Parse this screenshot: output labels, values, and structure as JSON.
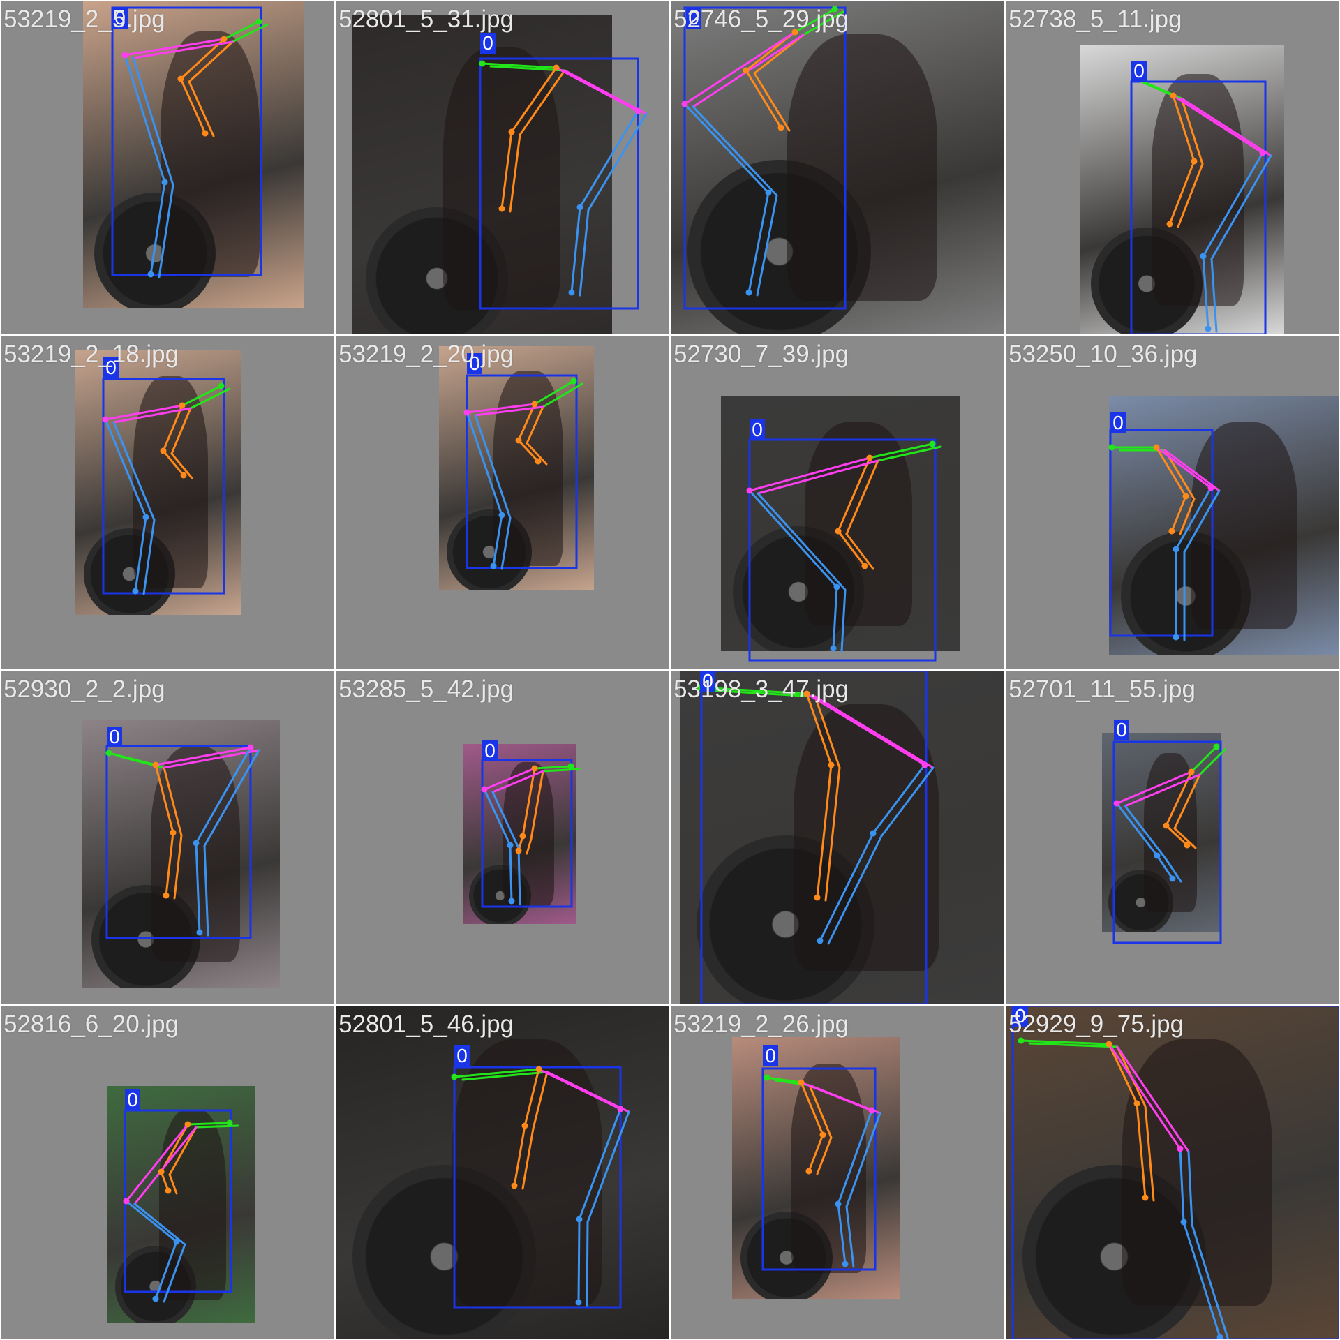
{
  "mosaic": {
    "tiles": [
      {
        "filename": "53219_2_5.jpg",
        "class_label": "0",
        "photo_tone": "#c9a38a"
      },
      {
        "filename": "52801_5_31.jpg",
        "class_label": "0",
        "photo_tone": "#2d2a29"
      },
      {
        "filename": "52746_5_29.jpg",
        "class_label": "0",
        "photo_tone": "#7f7f7f"
      },
      {
        "filename": "52738_5_11.jpg",
        "class_label": "0",
        "photo_tone": "#d9d9d9"
      },
      {
        "filename": "53219_2_18.jpg",
        "class_label": "0",
        "photo_tone": "#c6a48e"
      },
      {
        "filename": "53219_2_20.jpg",
        "class_label": "0",
        "photo_tone": "#c6a48e"
      },
      {
        "filename": "52730_7_39.jpg",
        "class_label": "0",
        "photo_tone": "#3a3a3a"
      },
      {
        "filename": "53250_10_36.jpg",
        "class_label": "0",
        "photo_tone": "#7b8ca8"
      },
      {
        "filename": "52930_2_2.jpg",
        "class_label": "0",
        "photo_tone": "#8e8488"
      },
      {
        "filename": "53285_5_42.jpg",
        "class_label": "0",
        "photo_tone": "#a05a8a"
      },
      {
        "filename": "53198_3_47.jpg",
        "class_label": "0",
        "photo_tone": "#3c3c3c"
      },
      {
        "filename": "52701_11_55.jpg",
        "class_label": "0",
        "photo_tone": "#5f6670"
      },
      {
        "filename": "52816_6_20.jpg",
        "class_label": "0",
        "photo_tone": "#3f6b3f"
      },
      {
        "filename": "52801_5_46.jpg",
        "class_label": "0",
        "photo_tone": "#262523"
      },
      {
        "filename": "53219_2_26.jpg",
        "class_label": "0",
        "photo_tone": "#b88c7c"
      },
      {
        "filename": "52929_9_75.jpg",
        "class_label": "0",
        "photo_tone": "#5a4636"
      }
    ],
    "colors": {
      "bbox": "#1a34e8",
      "head_link": "#22e51a",
      "arm_link": "#ff8a1a",
      "torso_link": "#ff3ef0",
      "leg_link": "#3a93f0"
    }
  }
}
